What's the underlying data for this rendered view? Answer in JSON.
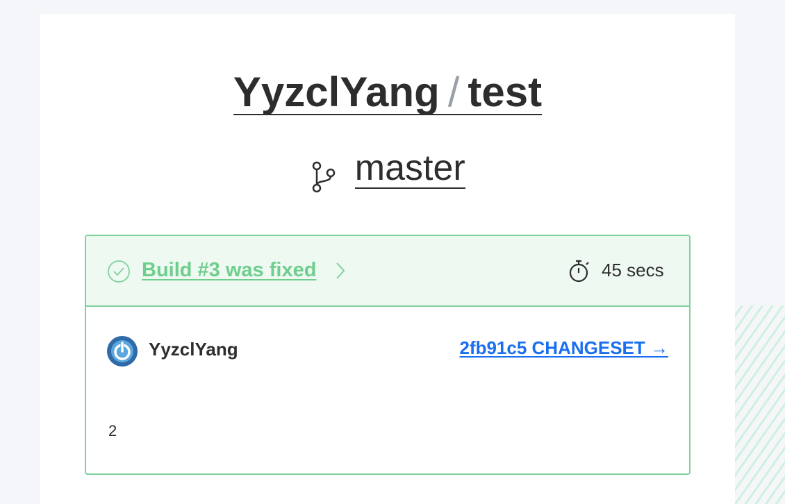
{
  "repo": {
    "owner": "YyzclYang",
    "separator": "/",
    "name": "test"
  },
  "branch": {
    "name": "master",
    "icon": "git-branch-icon"
  },
  "build": {
    "status_icon": "check-circle-icon",
    "title": "Build #3 was fixed",
    "chevron_icon": "chevron-right-icon",
    "timer_icon": "stopwatch-icon",
    "duration": "45 secs",
    "status_color": "#6fce8e",
    "author": "YyzclYang",
    "avatar_icon": "power-avatar-icon",
    "changeset": "2fb91c5 CHANGESET →",
    "message": "2"
  },
  "colors": {
    "success_border": "#7fd19c",
    "success_bg": "#eef9f1",
    "link_blue": "#1a6ff0"
  }
}
